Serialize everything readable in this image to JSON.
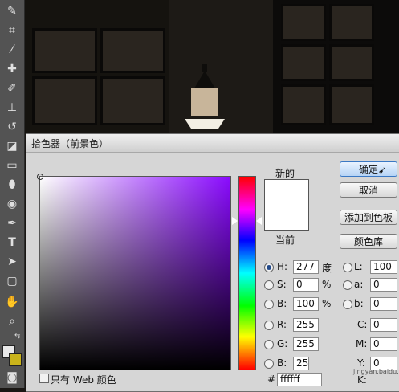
{
  "dialog": {
    "title": "拾色器（前景色）",
    "new_label": "新的",
    "current_label": "当前",
    "ok_label": "确定",
    "cancel_label": "取消",
    "add_swatch_label": "添加到色板",
    "libraries_label": "颜色库",
    "web_only_label": "只有 Web 颜色",
    "hsb": {
      "h_label": "H:",
      "h": "277",
      "h_unit": "度",
      "s_label": "S:",
      "s": "0",
      "s_unit": "%",
      "b_label": "B:",
      "b": "100",
      "b_unit": "%"
    },
    "rgb": {
      "r_label": "R:",
      "r": "255",
      "g_label": "G:",
      "g": "255",
      "b_label": "B:",
      "b": "25"
    },
    "lab": {
      "l_label": "L:",
      "l": "100",
      "a_label": "a:",
      "a": "0",
      "b_label": "b:",
      "b": "0"
    },
    "cmyk": {
      "c_label": "C:",
      "c": "0",
      "m_label": "M:",
      "m": "0",
      "y_label": "Y:",
      "y": "0",
      "k_label": "K:"
    },
    "hex_label": "#",
    "hex": "ffffff"
  },
  "watermark": "jingyan.baidu.com",
  "colors": {
    "selected_hue": "#8a0aff",
    "new_color": "#ffffff"
  }
}
